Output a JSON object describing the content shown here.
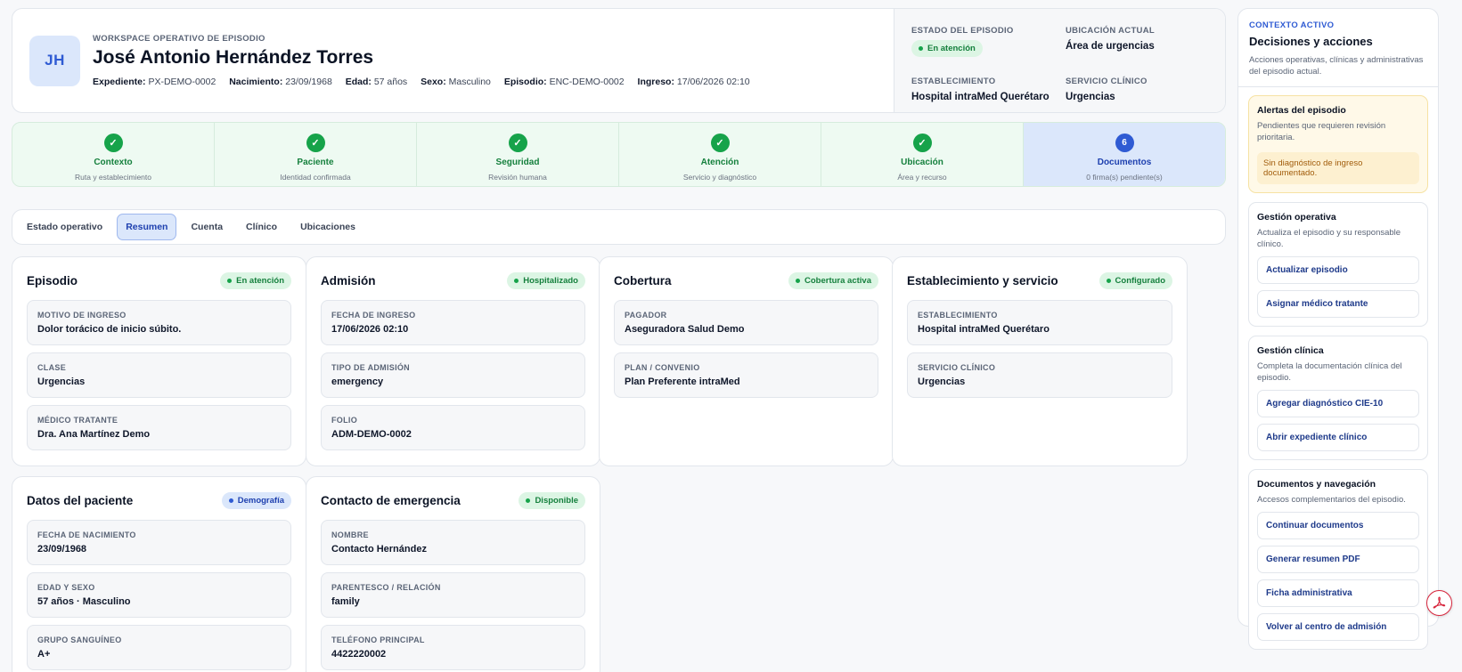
{
  "header": {
    "avatar_initials": "JH",
    "eyebrow": "WORKSPACE OPERATIVO DE EPISODIO",
    "patient_name": "José Antonio Hernández Torres",
    "meta": [
      {
        "label": "Expediente:",
        "value": "PX-DEMO-0002"
      },
      {
        "label": "Nacimiento:",
        "value": "23/09/1968"
      },
      {
        "label": "Edad:",
        "value": "57 años"
      },
      {
        "label": "Sexo:",
        "value": "Masculino"
      },
      {
        "label": "Episodio:",
        "value": "ENC-DEMO-0002"
      },
      {
        "label": "Ingreso:",
        "value": "17/06/2026 02:10"
      }
    ],
    "status_label": "ESTADO DEL EPISODIO",
    "status_value": "En atención",
    "location_label": "UBICACIÓN ACTUAL",
    "location_value": "Área de urgencias",
    "establishment_label": "ESTABLECIMIENTO",
    "establishment_value": "Hospital intraMed Querétaro",
    "service_label": "SERVICIO CLÍNICO",
    "service_value": "Urgencias"
  },
  "steps": [
    {
      "icon": "✓",
      "title": "Contexto",
      "subtitle": "Ruta y establecimiento"
    },
    {
      "icon": "✓",
      "title": "Paciente",
      "subtitle": "Identidad confirmada"
    },
    {
      "icon": "✓",
      "title": "Seguridad",
      "subtitle": "Revisión humana"
    },
    {
      "icon": "✓",
      "title": "Atención",
      "subtitle": "Servicio y diagnóstico"
    },
    {
      "icon": "✓",
      "title": "Ubicación",
      "subtitle": "Área y recurso"
    },
    {
      "icon": "6",
      "title": "Documentos",
      "subtitle": "0 firma(s) pendiente(s)"
    }
  ],
  "tabs": [
    "Estado operativo",
    "Resumen",
    "Cuenta",
    "Clínico",
    "Ubicaciones"
  ],
  "sections": {
    "episodio": {
      "title": "Episodio",
      "badge": "En atención",
      "fields": [
        {
          "label": "MOTIVO DE INGRESO",
          "value": "Dolor torácico de inicio súbito."
        },
        {
          "label": "CLASE",
          "value": "Urgencias"
        },
        {
          "label": "MÉDICO TRATANTE",
          "value": "Dra. Ana Martínez Demo"
        }
      ]
    },
    "admision": {
      "title": "Admisión",
      "badge": "Hospitalizado",
      "fields": [
        {
          "label": "FECHA DE INGRESO",
          "value": "17/06/2026 02:10"
        },
        {
          "label": "TIPO DE ADMISIÓN",
          "value": "emergency"
        },
        {
          "label": "FOLIO",
          "value": "ADM-DEMO-0002"
        }
      ]
    },
    "cobertura": {
      "title": "Cobertura",
      "badge": "Cobertura activa",
      "fields": [
        {
          "label": "PAGADOR",
          "value": "Aseguradora Salud Demo"
        },
        {
          "label": "PLAN / CONVENIO",
          "value": "Plan Preferente intraMed"
        }
      ]
    },
    "establecimiento": {
      "title": "Establecimiento y servicio",
      "badge": "Configurado",
      "fields": [
        {
          "label": "ESTABLECIMIENTO",
          "value": "Hospital intraMed Querétaro"
        },
        {
          "label": "SERVICIO CLÍNICO",
          "value": "Urgencias"
        }
      ]
    },
    "paciente": {
      "title": "Datos del paciente",
      "badge": "Demografía",
      "fields": [
        {
          "label": "FECHA DE NACIMIENTO",
          "value": "23/09/1968"
        },
        {
          "label": "EDAD Y SEXO",
          "value": "57 años · Masculino"
        },
        {
          "label": "GRUPO SANGUÍNEO",
          "value": "A+"
        }
      ]
    },
    "contacto": {
      "title": "Contacto de emergencia",
      "badge": "Disponible",
      "fields": [
        {
          "label": "NOMBRE",
          "value": "Contacto Hernández"
        },
        {
          "label": "PARENTESCO / RELACIÓN",
          "value": "family"
        },
        {
          "label": "TELÉFONO PRINCIPAL",
          "value": "4422220002"
        }
      ]
    }
  },
  "panel": {
    "eyebrow": "CONTEXTO ACTIVO",
    "title": "Decisiones y acciones",
    "description": "Acciones operativas, clínicas y administrativas del episodio actual.",
    "alerts": {
      "title": "Alertas del episodio",
      "description": "Pendientes que requieren revisión prioritaria.",
      "message": "Sin diagnóstico de ingreso documentado."
    },
    "operativa": {
      "title": "Gestión operativa",
      "description": "Actualiza el episodio y su responsable clínico.",
      "actions": [
        "Actualizar episodio",
        "Asignar médico tratante"
      ]
    },
    "clinica": {
      "title": "Gestión clínica",
      "description": "Completa la documentación clínica del episodio.",
      "actions": [
        "Agregar diagnóstico CIE-10",
        "Abrir expediente clínico"
      ]
    },
    "documentos": {
      "title": "Documentos y navegación",
      "description": "Accesos complementarios del episodio.",
      "actions": [
        "Continuar documentos",
        "Generar resumen PDF",
        "Ficha administrativa",
        "Volver al centro de admisión"
      ]
    }
  },
  "colors": {
    "accent": "#2f5bd3",
    "success": "#16a34a",
    "warning_bg": "#fff9e8",
    "pdf_red": "#d7263d"
  }
}
